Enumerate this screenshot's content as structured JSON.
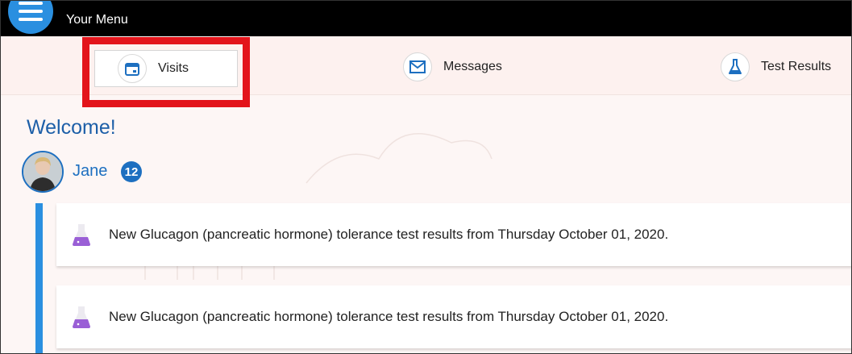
{
  "header": {
    "title": "Your Menu"
  },
  "tabs": [
    {
      "label": "Visits",
      "icon": "calendar-icon"
    },
    {
      "label": "Messages",
      "icon": "envelope-icon"
    },
    {
      "label": "Test Results",
      "icon": "flask-icon"
    }
  ],
  "main": {
    "welcome": "Welcome!",
    "user": {
      "name": "Jane",
      "badge_count": "12"
    },
    "feed": [
      {
        "text": "New Glucagon (pancreatic hormone) tolerance test results from Thursday October 01, 2020.",
        "icon": "flask-icon"
      },
      {
        "text": "New Glucagon (pancreatic hormone) tolerance test results from Thursday October 01, 2020.",
        "icon": "flask-icon"
      }
    ]
  },
  "colors": {
    "accent": "#2a8fe0",
    "highlight": "#e3141b",
    "topbar": "#000000",
    "title_blue": "#1d5fa8"
  }
}
